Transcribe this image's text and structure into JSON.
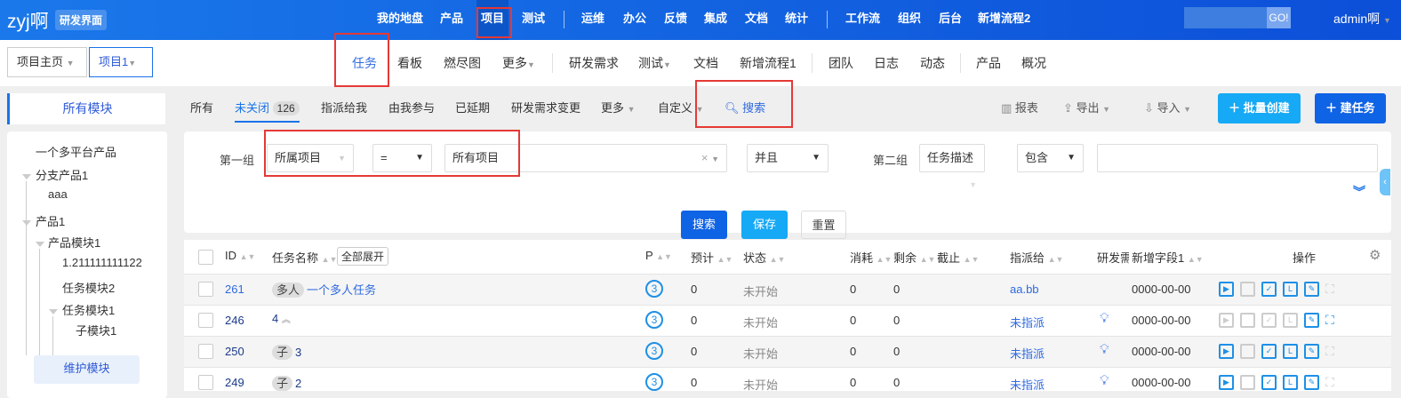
{
  "topbar": {
    "logo": "zyj啊",
    "badge": "研发界面",
    "nav": [
      "我的地盘",
      "产品",
      "项目",
      "测试",
      "运维",
      "办公",
      "反馈",
      "集成",
      "文档",
      "统计",
      "工作流",
      "组织",
      "后台",
      "新增流程2"
    ],
    "go": "GO!",
    "user": "admin啊"
  },
  "breadcrumb": [
    "项目主页",
    "项目1"
  ],
  "subnav": [
    "任务",
    "看板",
    "燃尽图",
    "更多",
    "研发需求",
    "测试",
    "文档",
    "新增流程1",
    "团队",
    "日志",
    "动态",
    "产品",
    "概况"
  ],
  "module_header": "所有模块",
  "filters": {
    "tabs": [
      "所有",
      "未关闭",
      "指派给我",
      "由我参与",
      "已延期",
      "研发需求变更",
      "更多",
      "自定义"
    ],
    "unclosed_count": "126",
    "search": "搜索"
  },
  "actions": {
    "report": "报表",
    "export": "导出",
    "import": "导入",
    "batch_create": "批量创建",
    "create_task": "建任务"
  },
  "tree": {
    "items": [
      "一个多平台产品",
      "分支产品1",
      "aaa",
      "产品1",
      "产品模块1",
      "1.211111111122",
      "任务模块2",
      "任务模块1",
      "子模块1"
    ],
    "maintain": "维护模块"
  },
  "search": {
    "group1": "第一组",
    "field1": "所属项目",
    "op1": "=",
    "value1": "所有项目",
    "logic": "并且",
    "group2": "第二组",
    "field2": "任务描述",
    "op2": "包含",
    "value2": "",
    "search_btn": "搜索",
    "save_btn": "保存",
    "reset_btn": "重置"
  },
  "table": {
    "headers": {
      "id": "ID",
      "name": "任务名称",
      "expand_all": "全部展开",
      "p": "P",
      "estimate": "预计",
      "status": "状态",
      "consumed": "消耗",
      "left": "剩余",
      "deadline": "截止",
      "assigned": "指派给",
      "story": "研发需",
      "field1": "新增字段1",
      "actions": "操作"
    },
    "rows": [
      {
        "id": "261",
        "tag": "多人",
        "name": "一个多人任务",
        "p": "3",
        "estimate": "0",
        "status": "未开始",
        "consumed": "0",
        "left": "0",
        "assigned": "aa.bb",
        "field1": "0000-00-00"
      },
      {
        "id": "246",
        "tag": "",
        "name": "4",
        "p": "3",
        "estimate": "0",
        "status": "未开始",
        "consumed": "0",
        "left": "0",
        "assigned": "未指派",
        "field1": "0000-00-00"
      },
      {
        "id": "250",
        "tag": "子",
        "name": "3",
        "p": "3",
        "estimate": "0",
        "status": "未开始",
        "consumed": "0",
        "left": "0",
        "assigned": "未指派",
        "field1": "0000-00-00"
      },
      {
        "id": "249",
        "tag": "子",
        "name": "2",
        "p": "3",
        "estimate": "0",
        "status": "未开始",
        "consumed": "0",
        "left": "0",
        "assigned": "未指派",
        "field1": "0000-00-00"
      }
    ]
  },
  "colors": {
    "primary": "#1a73e8",
    "accent": "#16a9f5",
    "highlight": "#e53935"
  }
}
